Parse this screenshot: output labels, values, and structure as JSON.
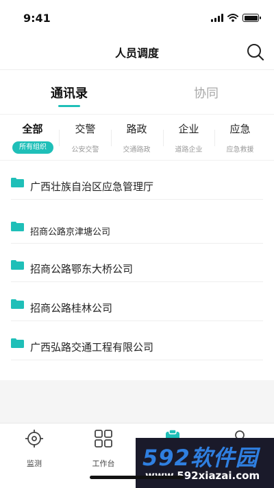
{
  "status_bar": {
    "time": "9:41",
    "icons": [
      "signal-icon",
      "wifi-icon",
      "battery-icon"
    ]
  },
  "nav": {
    "title": "人员调度",
    "search_icon": "search-icon"
  },
  "main_tabs": [
    {
      "label": "通讯录",
      "active": true
    },
    {
      "label": "协同",
      "active": false
    }
  ],
  "categories": [
    {
      "name": "全部",
      "sub": "所有组织",
      "active": true
    },
    {
      "name": "交警",
      "sub": "公安交警",
      "active": false
    },
    {
      "name": "路政",
      "sub": "交通路政",
      "active": false
    },
    {
      "name": "企业",
      "sub": "道路企业",
      "active": false
    },
    {
      "name": "应急",
      "sub": "应急救援",
      "active": false
    }
  ],
  "org_list": [
    {
      "label": "广西壮族自治区应急管理厅",
      "icon": "folder-icon"
    },
    {
      "label": "招商公路京津塘公司",
      "icon": "folder-icon"
    },
    {
      "label": "招商公路鄂东大桥公司",
      "icon": "folder-icon"
    },
    {
      "label": "招商公路桂林公司",
      "icon": "folder-icon"
    },
    {
      "label": "广西弘路交通工程有限公司",
      "icon": "folder-icon"
    }
  ],
  "tab_bar": [
    {
      "label": "监测",
      "icon": "target-icon"
    },
    {
      "label": "工作台",
      "icon": "grid-icon"
    },
    {
      "label": "",
      "icon": "clipboard-icon"
    },
    {
      "label": "",
      "icon": "user-icon"
    }
  ],
  "watermark": {
    "brand": "592软件园",
    "url": "www.592xiazai.com"
  },
  "colors": {
    "accent": "#1fbfb8",
    "text": "#222222",
    "muted": "#999999",
    "inactive_tab": "#a8a8a8"
  }
}
